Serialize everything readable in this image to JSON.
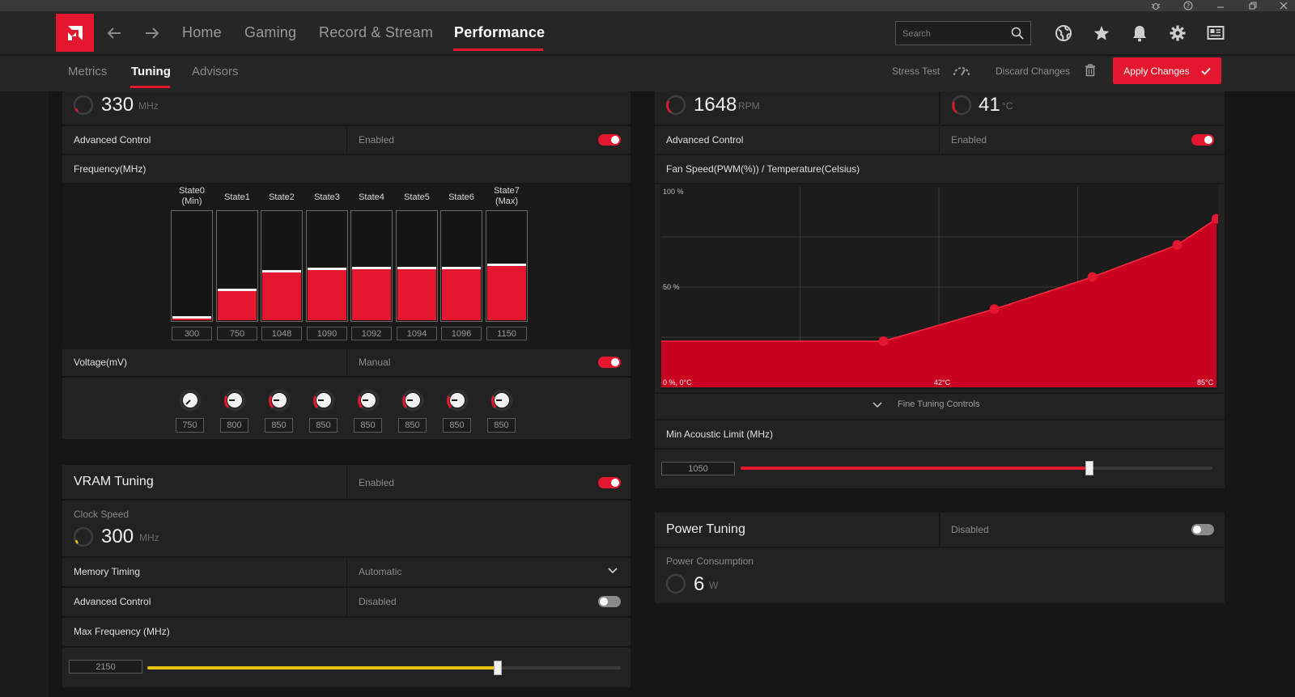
{
  "nav": {
    "tabs": [
      "Home",
      "Gaming",
      "Record & Stream",
      "Performance"
    ],
    "search_placeholder": "Search"
  },
  "subnav": {
    "tabs": [
      "Metrics",
      "Tuning",
      "Advisors"
    ],
    "stress_test": "Stress Test",
    "discard_changes": "Discard Changes",
    "apply_changes": "Apply Changes"
  },
  "gpu_tuning": {
    "clock_value": "330",
    "clock_unit": "MHz",
    "advanced_control_label": "Advanced Control",
    "advanced_control_value": "Enabled",
    "frequency_label": "Frequency(MHz)",
    "states": [
      {
        "label": "State0\n(Min)",
        "value": "300",
        "level": 0.02
      },
      {
        "label": "State1",
        "value": "750",
        "level": 0.27
      },
      {
        "label": "State2",
        "value": "1048",
        "level": 0.44
      },
      {
        "label": "State3",
        "value": "1090",
        "level": 0.46
      },
      {
        "label": "State4",
        "value": "1092",
        "level": 0.47
      },
      {
        "label": "State5",
        "value": "1094",
        "level": 0.47
      },
      {
        "label": "State6",
        "value": "1096",
        "level": 0.47
      },
      {
        "label": "State7\n(Max)",
        "value": "1150",
        "level": 0.5
      }
    ],
    "voltage_label": "Voltage(mV)",
    "voltage_value": "Manual",
    "voltages": [
      "750",
      "800",
      "850",
      "850",
      "850",
      "850",
      "850",
      "850"
    ]
  },
  "vram_tuning": {
    "title": "VRAM Tuning",
    "status": "Enabled",
    "clock_caption": "Clock Speed",
    "clock_value": "300",
    "clock_unit": "MHz",
    "memory_timing_label": "Memory Timing",
    "memory_timing_value": "Automatic",
    "advanced_control_label": "Advanced Control",
    "advanced_control_value": "Disabled",
    "max_freq_label": "Max Frequency (MHz)",
    "max_freq_value": "2150",
    "max_freq_level": 0.74,
    "accent_color": "#e8c20f"
  },
  "fan_tuning": {
    "fan_value": "1648",
    "fan_unit": "RPM",
    "temp_value": "41",
    "temp_unit": "°C",
    "advanced_control_label": "Advanced Control",
    "advanced_control_value": "Enabled",
    "curve_label": "Fan Speed(PWM(%)) / Temperature(Celsius)",
    "fine_tuning_label": "Fine Tuning Controls",
    "min_acoustic_label": "Min Acoustic Limit (MHz)",
    "min_acoustic_value": "1050",
    "min_acoustic_level": 0.74,
    "chart_data": {
      "type": "area",
      "tick_labels": {
        "y_top": "100 %",
        "y_mid": "50 %",
        "origin": "0 %, 0°C",
        "x_mid": "42°C",
        "x_max": "85°C"
      },
      "x": [
        0,
        34,
        51,
        66,
        79,
        85
      ],
      "y": [
        23,
        23,
        39,
        55,
        71,
        84
      ],
      "xlim": [
        0,
        85
      ],
      "ylim": [
        0,
        100
      ],
      "color": "#c9001f"
    }
  },
  "power_tuning": {
    "title": "Power Tuning",
    "status": "Disabled",
    "caption": "Power Consumption",
    "value": "6",
    "unit": "W"
  }
}
